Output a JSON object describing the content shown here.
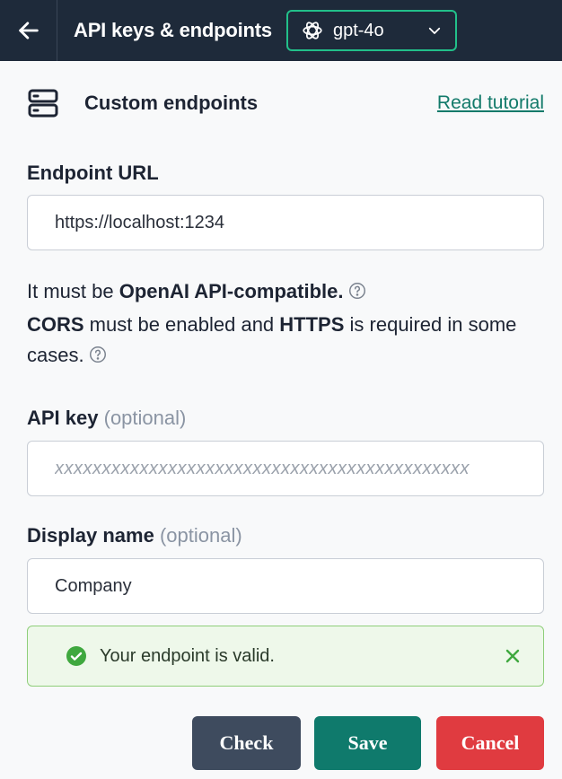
{
  "header": {
    "title": "API keys & endpoints",
    "model": "gpt-4o"
  },
  "section": {
    "title": "Custom endpoints",
    "tutorial_link": "Read tutorial"
  },
  "endpoint": {
    "label": "Endpoint URL",
    "value": "https://localhost:1234"
  },
  "help": {
    "line1_pre": "It must be ",
    "line1_bold": "OpenAI API-compatible.",
    "line2_bold1": "CORS",
    "line2_mid": " must be enabled and ",
    "line2_bold2": "HTTPS",
    "line2_post": " is required in some cases."
  },
  "api_key": {
    "label": "API key",
    "optional": "(optional)",
    "placeholder": "xxxxxxxxxxxxxxxxxxxxxxxxxxxxxxxxxxxxxxxxxxxx"
  },
  "display_name": {
    "label": "Display name",
    "optional": "(optional)",
    "value": "Company"
  },
  "status": {
    "message": "Your endpoint is valid."
  },
  "buttons": {
    "check": "Check",
    "save": "Save",
    "cancel": "Cancel"
  },
  "colors": {
    "header_bg": "#1e2a3a",
    "accent_green": "#22c08a",
    "save": "#0f7a6c",
    "cancel": "#e03b40",
    "check": "#3e4b5e"
  }
}
